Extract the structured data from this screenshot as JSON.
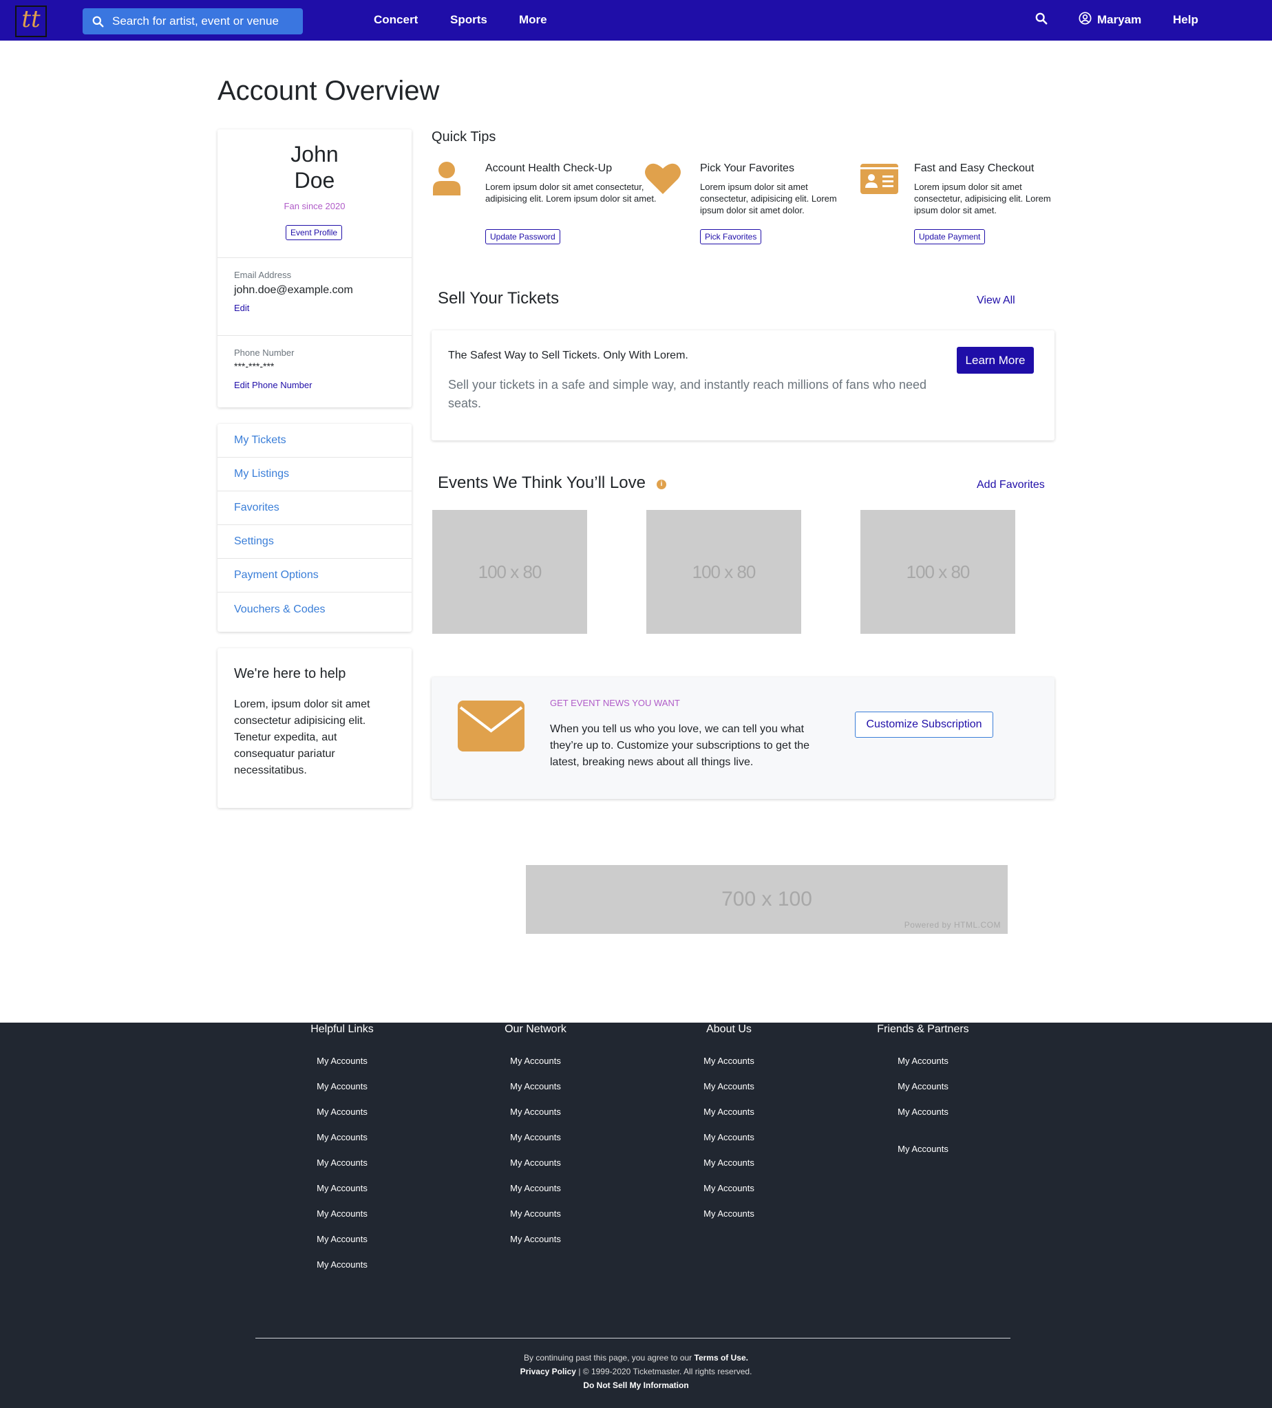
{
  "header": {
    "logo_text": "tt",
    "search_placeholder": "Search for artist, event or venue",
    "nav": [
      "Concert",
      "Sports",
      "More"
    ],
    "user_name": "Maryam",
    "help": "Help",
    "brand_color": "#1f0ea8"
  },
  "page_title": "Account Overview",
  "profile": {
    "first_name": "John",
    "last_name": "Doe",
    "fan_since": "Fan since 2020",
    "event_profile_button": "Event Profile",
    "email_label": "Email Address",
    "email_value": "john.doe@example.com",
    "email_edit": "Edit",
    "phone_label": "Phone Number",
    "phone_value": "***-***-***",
    "phone_edit": "Edit Phone Number"
  },
  "menu": [
    "My Tickets",
    "My Listings",
    "Favorites",
    "Settings",
    "Payment Options",
    "Vouchers & Codes"
  ],
  "help": {
    "title": "We're here to help",
    "body": "Lorem, ipsum dolor sit amet consectetur adipisicing elit. Tenetur expedita, aut consequatur pariatur necessitatibus."
  },
  "quick_tips": {
    "title": "Quick Tips",
    "tips": [
      {
        "icon": "user-icon",
        "title": "Account Health Check-Up",
        "body": "Lorem ipsum dolor sit amet consectetur, adipisicing elit. Lorem ipsum dolor sit amet.",
        "button": "Update Password"
      },
      {
        "icon": "heart-icon",
        "title": "Pick Your Favorites",
        "body": "Lorem ipsum dolor sit amet consectetur, adipisicing elit. Lorem ipsum dolor sit amet dolor.",
        "button": "Pick Favorites"
      },
      {
        "icon": "id-card-icon",
        "title": "Fast and Easy Checkout",
        "body": "Lorem ipsum dolor sit amet consectetur, adipisicing elit. Lorem ipsum dolor sit amet.",
        "button": "Update Payment"
      }
    ]
  },
  "sell": {
    "title": "Sell Your Tickets",
    "view_all": "View All",
    "card_heading": "The Safest Way to Sell Tickets. Only With Lorem.",
    "card_body": "Sell your tickets in a safe and simple way, and instantly reach millions of fans who need seats.",
    "button": "Learn More"
  },
  "events": {
    "title": "Events We Think You’ll Love",
    "info_glyph": "i",
    "add_favorites": "Add Favorites",
    "placeholders": [
      "100 x 80",
      "100 x 80",
      "100 x 80"
    ]
  },
  "news": {
    "eyebrow": "GET EVENT NEWS YOU WANT",
    "body": "When you tell us who you love, we can tell you what they’re up to. Customize your subscriptions to get the latest, breaking news about all things live.",
    "button": "Customize Subscription"
  },
  "banner": {
    "label": "700 x 100",
    "powered": "Powered by HTML.COM"
  },
  "footer": {
    "columns": [
      {
        "title": "Helpful Links",
        "links": [
          "My Accounts",
          "My Accounts",
          "My Accounts",
          "My Accounts",
          "My Accounts",
          "My Accounts",
          "My Accounts",
          "My Accounts",
          "My Accounts"
        ]
      },
      {
        "title": "Our Network",
        "links": [
          "My Accounts",
          "My Accounts",
          "My Accounts",
          "My Accounts",
          "My Accounts",
          "My Accounts",
          "My Accounts",
          "My Accounts"
        ]
      },
      {
        "title": "About Us",
        "links": [
          "My Accounts",
          "My Accounts",
          "My Accounts",
          "My Accounts",
          "My Accounts",
          "My Accounts",
          "My Accounts"
        ]
      },
      {
        "title": "Friends & Partners",
        "links": [
          "My Accounts",
          "My Accounts",
          "My Accounts",
          "My Accounts"
        ]
      }
    ],
    "legal_prefix": "By continuing past this page, you agree to our",
    "terms": "Terms of Use.",
    "privacy": "Privacy Policy",
    "copyright": "| © 1999-2020 Ticketmaster. All rights reserved.",
    "do_not_sell": "Do Not Sell My Information"
  }
}
